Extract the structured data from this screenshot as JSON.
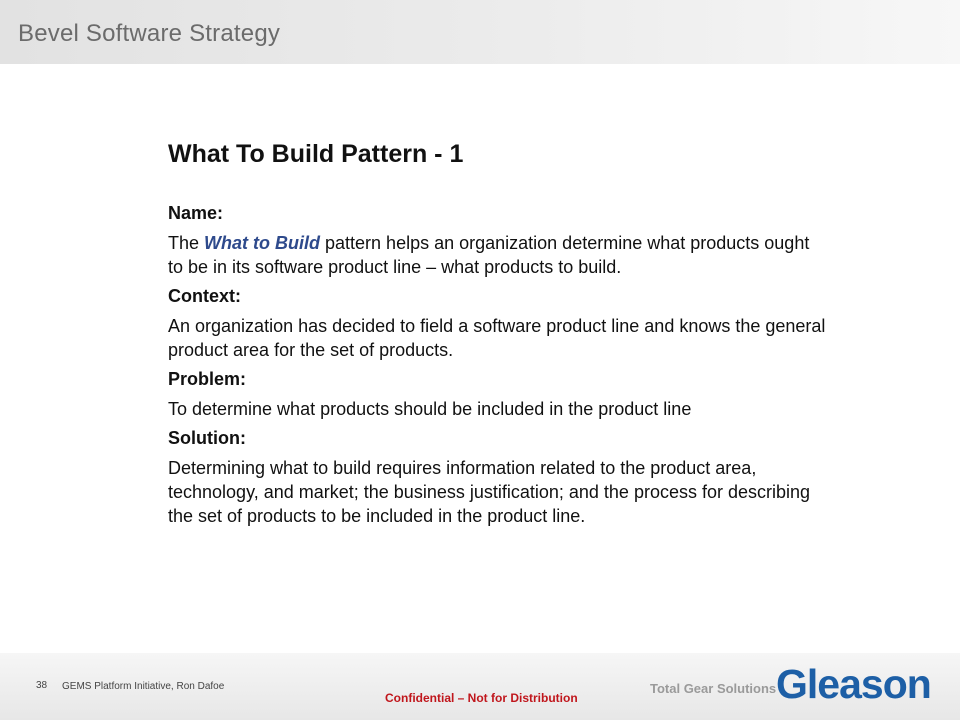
{
  "header": {
    "title": "Bevel Software Strategy"
  },
  "slide": {
    "heading": "What To Build Pattern - 1",
    "sections": {
      "name": {
        "label": "Name:",
        "body_before": "The ",
        "body_emph": "What to Build",
        "body_after": " pattern helps an organization determine what products ought to be in its software product line – what products to build."
      },
      "context": {
        "label": "Context:",
        "body": "An organization has decided to field a software product line and knows the general product area for the set of products."
      },
      "problem": {
        "label": "Problem:",
        "body": "To determine what products should be included in the product line"
      },
      "solution": {
        "label": "Solution:",
        "body": "Determining what to build requires information related to the product area, technology, and market; the business justification; and the process for describing the set of products to be included in the product line."
      }
    }
  },
  "footer": {
    "page_number": "38",
    "text": "GEMS Platform Initiative, Ron Dafoe",
    "confidential": "Confidential – Not for Distribution",
    "tagline": "Total Gear Solutions",
    "logo": "Gleason"
  },
  "colors": {
    "emphasis": "#2e4a8c",
    "confidential": "#c0161c",
    "logo": "#1d5fa6"
  }
}
